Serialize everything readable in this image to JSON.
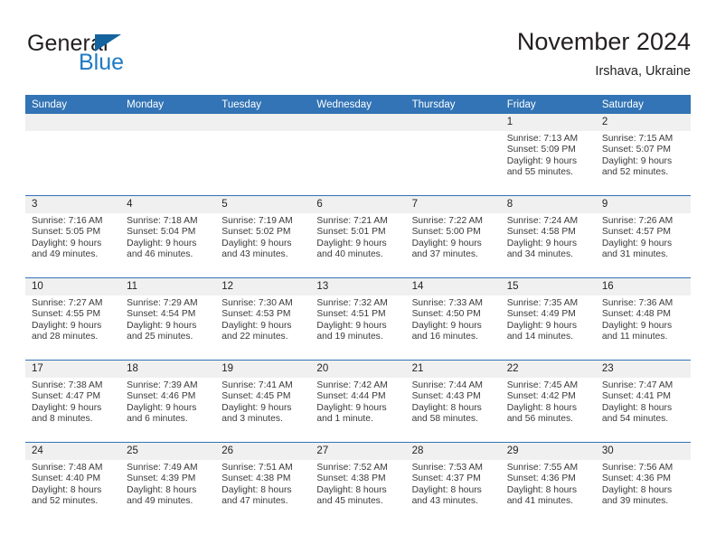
{
  "brand": {
    "name_part1": "General",
    "name_part2": "Blue",
    "accent_color": "#1f7ac4",
    "triangle_color": "#14639e"
  },
  "header": {
    "title": "November 2024",
    "location": "Irshava, Ukraine"
  },
  "theme": {
    "header_row_bg": "#3274b5",
    "day_band_bg": "#f0f0f0",
    "text_color": "#231f20",
    "divider_color": "#3274b5"
  },
  "weekday_headers": [
    "Sunday",
    "Monday",
    "Tuesday",
    "Wednesday",
    "Thursday",
    "Friday",
    "Saturday"
  ],
  "weeks": [
    [
      {
        "day": "",
        "sunrise": "",
        "sunset": "",
        "daylight_line1": "",
        "daylight_line2": "",
        "empty": true
      },
      {
        "day": "",
        "sunrise": "",
        "sunset": "",
        "daylight_line1": "",
        "daylight_line2": "",
        "empty": true
      },
      {
        "day": "",
        "sunrise": "",
        "sunset": "",
        "daylight_line1": "",
        "daylight_line2": "",
        "empty": true
      },
      {
        "day": "",
        "sunrise": "",
        "sunset": "",
        "daylight_line1": "",
        "daylight_line2": "",
        "empty": true
      },
      {
        "day": "",
        "sunrise": "",
        "sunset": "",
        "daylight_line1": "",
        "daylight_line2": "",
        "empty": true
      },
      {
        "day": "1",
        "sunrise": "Sunrise: 7:13 AM",
        "sunset": "Sunset: 5:09 PM",
        "daylight_line1": "Daylight: 9 hours",
        "daylight_line2": "and 55 minutes.",
        "empty": false
      },
      {
        "day": "2",
        "sunrise": "Sunrise: 7:15 AM",
        "sunset": "Sunset: 5:07 PM",
        "daylight_line1": "Daylight: 9 hours",
        "daylight_line2": "and 52 minutes.",
        "empty": false
      }
    ],
    [
      {
        "day": "3",
        "sunrise": "Sunrise: 7:16 AM",
        "sunset": "Sunset: 5:05 PM",
        "daylight_line1": "Daylight: 9 hours",
        "daylight_line2": "and 49 minutes.",
        "empty": false
      },
      {
        "day": "4",
        "sunrise": "Sunrise: 7:18 AM",
        "sunset": "Sunset: 5:04 PM",
        "daylight_line1": "Daylight: 9 hours",
        "daylight_line2": "and 46 minutes.",
        "empty": false
      },
      {
        "day": "5",
        "sunrise": "Sunrise: 7:19 AM",
        "sunset": "Sunset: 5:02 PM",
        "daylight_line1": "Daylight: 9 hours",
        "daylight_line2": "and 43 minutes.",
        "empty": false
      },
      {
        "day": "6",
        "sunrise": "Sunrise: 7:21 AM",
        "sunset": "Sunset: 5:01 PM",
        "daylight_line1": "Daylight: 9 hours",
        "daylight_line2": "and 40 minutes.",
        "empty": false
      },
      {
        "day": "7",
        "sunrise": "Sunrise: 7:22 AM",
        "sunset": "Sunset: 5:00 PM",
        "daylight_line1": "Daylight: 9 hours",
        "daylight_line2": "and 37 minutes.",
        "empty": false
      },
      {
        "day": "8",
        "sunrise": "Sunrise: 7:24 AM",
        "sunset": "Sunset: 4:58 PM",
        "daylight_line1": "Daylight: 9 hours",
        "daylight_line2": "and 34 minutes.",
        "empty": false
      },
      {
        "day": "9",
        "sunrise": "Sunrise: 7:26 AM",
        "sunset": "Sunset: 4:57 PM",
        "daylight_line1": "Daylight: 9 hours",
        "daylight_line2": "and 31 minutes.",
        "empty": false
      }
    ],
    [
      {
        "day": "10",
        "sunrise": "Sunrise: 7:27 AM",
        "sunset": "Sunset: 4:55 PM",
        "daylight_line1": "Daylight: 9 hours",
        "daylight_line2": "and 28 minutes.",
        "empty": false
      },
      {
        "day": "11",
        "sunrise": "Sunrise: 7:29 AM",
        "sunset": "Sunset: 4:54 PM",
        "daylight_line1": "Daylight: 9 hours",
        "daylight_line2": "and 25 minutes.",
        "empty": false
      },
      {
        "day": "12",
        "sunrise": "Sunrise: 7:30 AM",
        "sunset": "Sunset: 4:53 PM",
        "daylight_line1": "Daylight: 9 hours",
        "daylight_line2": "and 22 minutes.",
        "empty": false
      },
      {
        "day": "13",
        "sunrise": "Sunrise: 7:32 AM",
        "sunset": "Sunset: 4:51 PM",
        "daylight_line1": "Daylight: 9 hours",
        "daylight_line2": "and 19 minutes.",
        "empty": false
      },
      {
        "day": "14",
        "sunrise": "Sunrise: 7:33 AM",
        "sunset": "Sunset: 4:50 PM",
        "daylight_line1": "Daylight: 9 hours",
        "daylight_line2": "and 16 minutes.",
        "empty": false
      },
      {
        "day": "15",
        "sunrise": "Sunrise: 7:35 AM",
        "sunset": "Sunset: 4:49 PM",
        "daylight_line1": "Daylight: 9 hours",
        "daylight_line2": "and 14 minutes.",
        "empty": false
      },
      {
        "day": "16",
        "sunrise": "Sunrise: 7:36 AM",
        "sunset": "Sunset: 4:48 PM",
        "daylight_line1": "Daylight: 9 hours",
        "daylight_line2": "and 11 minutes.",
        "empty": false
      }
    ],
    [
      {
        "day": "17",
        "sunrise": "Sunrise: 7:38 AM",
        "sunset": "Sunset: 4:47 PM",
        "daylight_line1": "Daylight: 9 hours",
        "daylight_line2": "and 8 minutes.",
        "empty": false
      },
      {
        "day": "18",
        "sunrise": "Sunrise: 7:39 AM",
        "sunset": "Sunset: 4:46 PM",
        "daylight_line1": "Daylight: 9 hours",
        "daylight_line2": "and 6 minutes.",
        "empty": false
      },
      {
        "day": "19",
        "sunrise": "Sunrise: 7:41 AM",
        "sunset": "Sunset: 4:45 PM",
        "daylight_line1": "Daylight: 9 hours",
        "daylight_line2": "and 3 minutes.",
        "empty": false
      },
      {
        "day": "20",
        "sunrise": "Sunrise: 7:42 AM",
        "sunset": "Sunset: 4:44 PM",
        "daylight_line1": "Daylight: 9 hours",
        "daylight_line2": "and 1 minute.",
        "empty": false
      },
      {
        "day": "21",
        "sunrise": "Sunrise: 7:44 AM",
        "sunset": "Sunset: 4:43 PM",
        "daylight_line1": "Daylight: 8 hours",
        "daylight_line2": "and 58 minutes.",
        "empty": false
      },
      {
        "day": "22",
        "sunrise": "Sunrise: 7:45 AM",
        "sunset": "Sunset: 4:42 PM",
        "daylight_line1": "Daylight: 8 hours",
        "daylight_line2": "and 56 minutes.",
        "empty": false
      },
      {
        "day": "23",
        "sunrise": "Sunrise: 7:47 AM",
        "sunset": "Sunset: 4:41 PM",
        "daylight_line1": "Daylight: 8 hours",
        "daylight_line2": "and 54 minutes.",
        "empty": false
      }
    ],
    [
      {
        "day": "24",
        "sunrise": "Sunrise: 7:48 AM",
        "sunset": "Sunset: 4:40 PM",
        "daylight_line1": "Daylight: 8 hours",
        "daylight_line2": "and 52 minutes.",
        "empty": false
      },
      {
        "day": "25",
        "sunrise": "Sunrise: 7:49 AM",
        "sunset": "Sunset: 4:39 PM",
        "daylight_line1": "Daylight: 8 hours",
        "daylight_line2": "and 49 minutes.",
        "empty": false
      },
      {
        "day": "26",
        "sunrise": "Sunrise: 7:51 AM",
        "sunset": "Sunset: 4:38 PM",
        "daylight_line1": "Daylight: 8 hours",
        "daylight_line2": "and 47 minutes.",
        "empty": false
      },
      {
        "day": "27",
        "sunrise": "Sunrise: 7:52 AM",
        "sunset": "Sunset: 4:38 PM",
        "daylight_line1": "Daylight: 8 hours",
        "daylight_line2": "and 45 minutes.",
        "empty": false
      },
      {
        "day": "28",
        "sunrise": "Sunrise: 7:53 AM",
        "sunset": "Sunset: 4:37 PM",
        "daylight_line1": "Daylight: 8 hours",
        "daylight_line2": "and 43 minutes.",
        "empty": false
      },
      {
        "day": "29",
        "sunrise": "Sunrise: 7:55 AM",
        "sunset": "Sunset: 4:36 PM",
        "daylight_line1": "Daylight: 8 hours",
        "daylight_line2": "and 41 minutes.",
        "empty": false
      },
      {
        "day": "30",
        "sunrise": "Sunrise: 7:56 AM",
        "sunset": "Sunset: 4:36 PM",
        "daylight_line1": "Daylight: 8 hours",
        "daylight_line2": "and 39 minutes.",
        "empty": false
      }
    ]
  ]
}
